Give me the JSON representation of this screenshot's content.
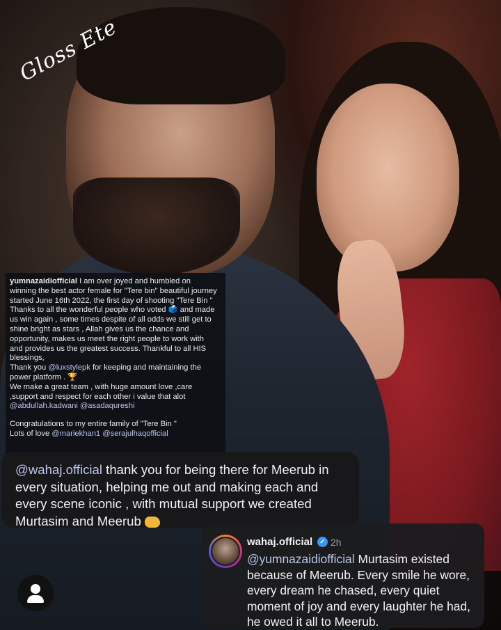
{
  "watermark": "Gloss Ete",
  "caption": {
    "username": "yumnazaidiofficial",
    "line1": " I am over joyed and humbled on winning the best actor female  for \"Tere bin\" beautiful journey started June 16th 2022, the first day of shooting \"Tere Bin \"  Thanks to all the wonderful people who voted ",
    "line1b": " and made us win again , some times despite of all odds we still get to shine bright as stars , Allah gives us the chance and opportunity, makes us meet the right people to work with and provides us the greatest success. Thankful to all HIS blessings,",
    "thanks_prefix": "Thank you ",
    "thanks_mention": "@luxstylepk",
    "thanks_suffix": " for keeping and maintaining the power platform . ",
    "team_text": "We make a great team , with huge amount love ,care ,support and respect for each other i value that alot ",
    "team_mention1": "@abdullah.kadwani",
    "team_mention2": "@asadaqureshi",
    "congrats": "Congratulations to my entire family of \"Tere Bin \"",
    "love_prefix": "Lots of love ",
    "love_mention1": "@mariekhan1",
    "love_mention2": "@serajulhaqofficial"
  },
  "reply": {
    "mention": "@wahaj.official",
    "text": " thank you for being there for Meerub in every situation, helping me out and making each and every scene iconic , with mutual support we created Murtasim and Meerub "
  },
  "comment": {
    "username": "wahaj.official",
    "time": "2h",
    "mention": "@yumnazaidiofficial",
    "text": " Murtasim existed because of Meerub. Every smile he wore, every dream he chased, every quiet moment of joy and every laughter he had, he owed it all to Meerub."
  },
  "icons": {
    "verified": "verified-badge-icon",
    "profile": "profile-icon",
    "handshake": "handshake-emoji-icon"
  },
  "colors": {
    "mention": "#b9c6e8",
    "verified": "#3897f0"
  }
}
